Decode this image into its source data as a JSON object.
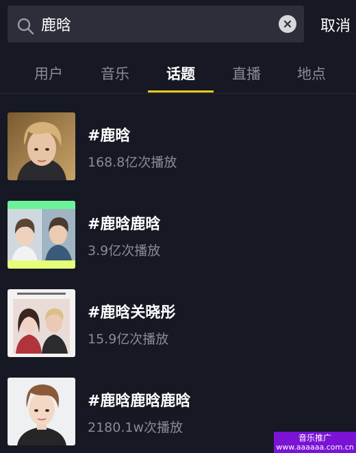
{
  "search": {
    "query": "鹿晗",
    "cancel_label": "取消"
  },
  "tabs": [
    {
      "label": "用户",
      "active": false
    },
    {
      "label": "音乐",
      "active": false
    },
    {
      "label": "话题",
      "active": true
    },
    {
      "label": "直播",
      "active": false
    },
    {
      "label": "地点",
      "active": false
    }
  ],
  "results": [
    {
      "title": "#鹿晗",
      "plays": "168.8亿次播放",
      "thumb_icon": "portrait-photo"
    },
    {
      "title": "#鹿晗鹿晗",
      "plays": "3.9亿次播放",
      "thumb_icon": "two-portrait-collage"
    },
    {
      "title": "#鹿晗关晓彤",
      "plays": "15.9亿次播放",
      "thumb_icon": "couple-photo"
    },
    {
      "title": "#鹿晗鹿晗鹿晗",
      "plays": "2180.1w次播放",
      "thumb_icon": "portrait-photo"
    }
  ],
  "watermark": {
    "line1": "音乐推广",
    "line2": "www.aaaaaa.com.cn"
  },
  "colors": {
    "background": "#161823",
    "accent": "#face15",
    "muted_text": "#8a8c94"
  }
}
